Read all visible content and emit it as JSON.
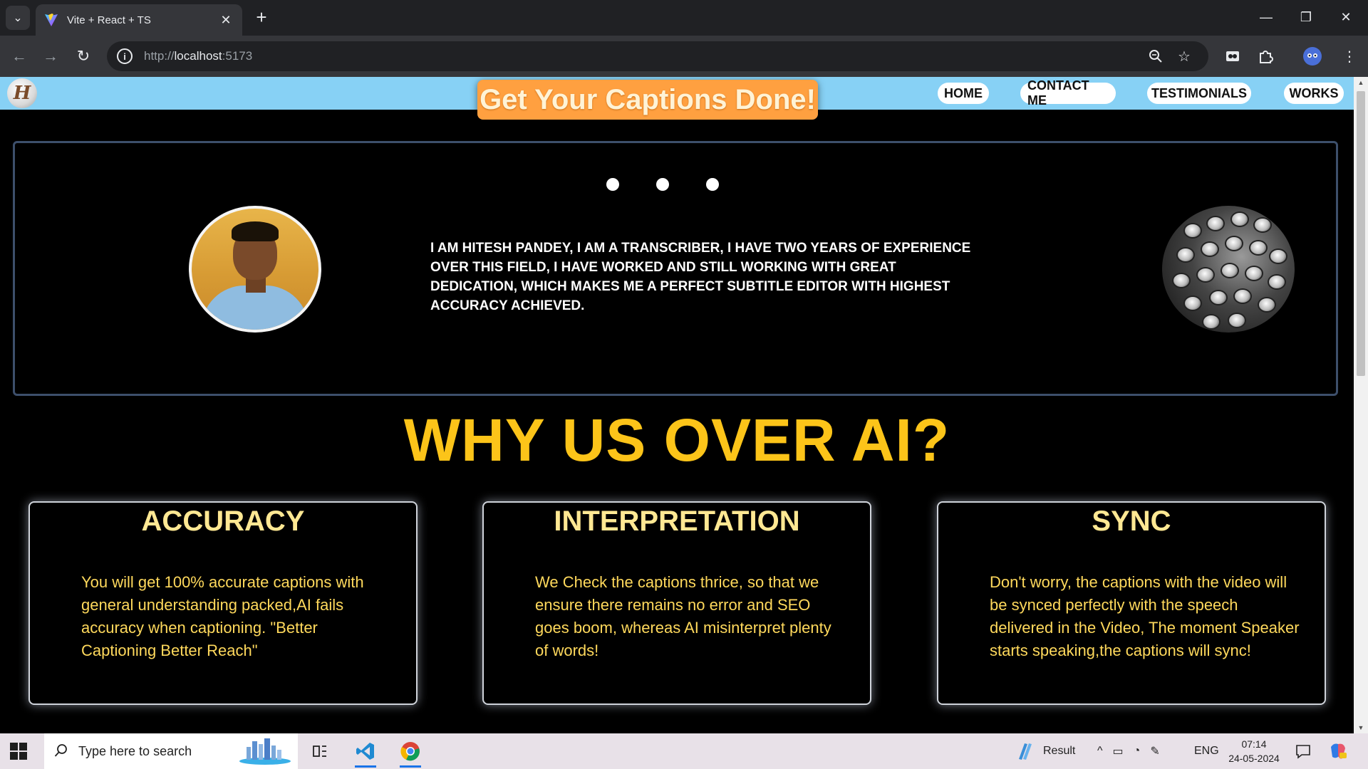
{
  "browser": {
    "tab_title": "Vite + React + TS",
    "url_host": "localhost",
    "url_prefix": "http://",
    "url_port": ":5173"
  },
  "site": {
    "logo_letter": "H",
    "hero_title": "Get Your Captions Done!",
    "nav": [
      "HOME",
      "CONTACT ME",
      "TESTIMONIALS",
      "WORKS"
    ],
    "about_text": "I AM HITESH PANDEY, I AM A TRANSCRIBER, I HAVE TWO YEARS OF EXPERIENCE OVER THIS FIELD, I HAVE WORKED AND STILL WORKING WITH GREAT DEDICATION, WHICH MAKES ME A PERFECT SUBTITLE EDITOR WITH HIGHEST ACCURACY ACHIEVED.",
    "why_title": "WHY US OVER AI?",
    "cards": [
      {
        "title": "ACCURACY",
        "text": "You will get 100% accurate captions with general understanding packed,AI fails accuracy when captioning. \"Better Captioning Better Reach\""
      },
      {
        "title": "INTERPRETATION",
        "text": "We Check the captions thrice, so that we ensure there remains no error and SEO goes boom, whereas AI misinterpret plenty of words!"
      },
      {
        "title": "SYNC",
        "text": "Don't worry, the captions with the video will be synced perfectly with the speech delivered in the Video, The moment Speaker starts speaking,the captions will sync!"
      }
    ]
  },
  "taskbar": {
    "search_placeholder": "Type here to search",
    "weather_label": "Result",
    "lang": "ENG",
    "time": "07:14",
    "date": "24-05-2024"
  },
  "colors": {
    "header_bg": "#87d1f5",
    "hero_pill": "#ffa040",
    "why_title": "#fcc419",
    "card_title": "#ffe893",
    "card_text": "#ffd95c"
  }
}
